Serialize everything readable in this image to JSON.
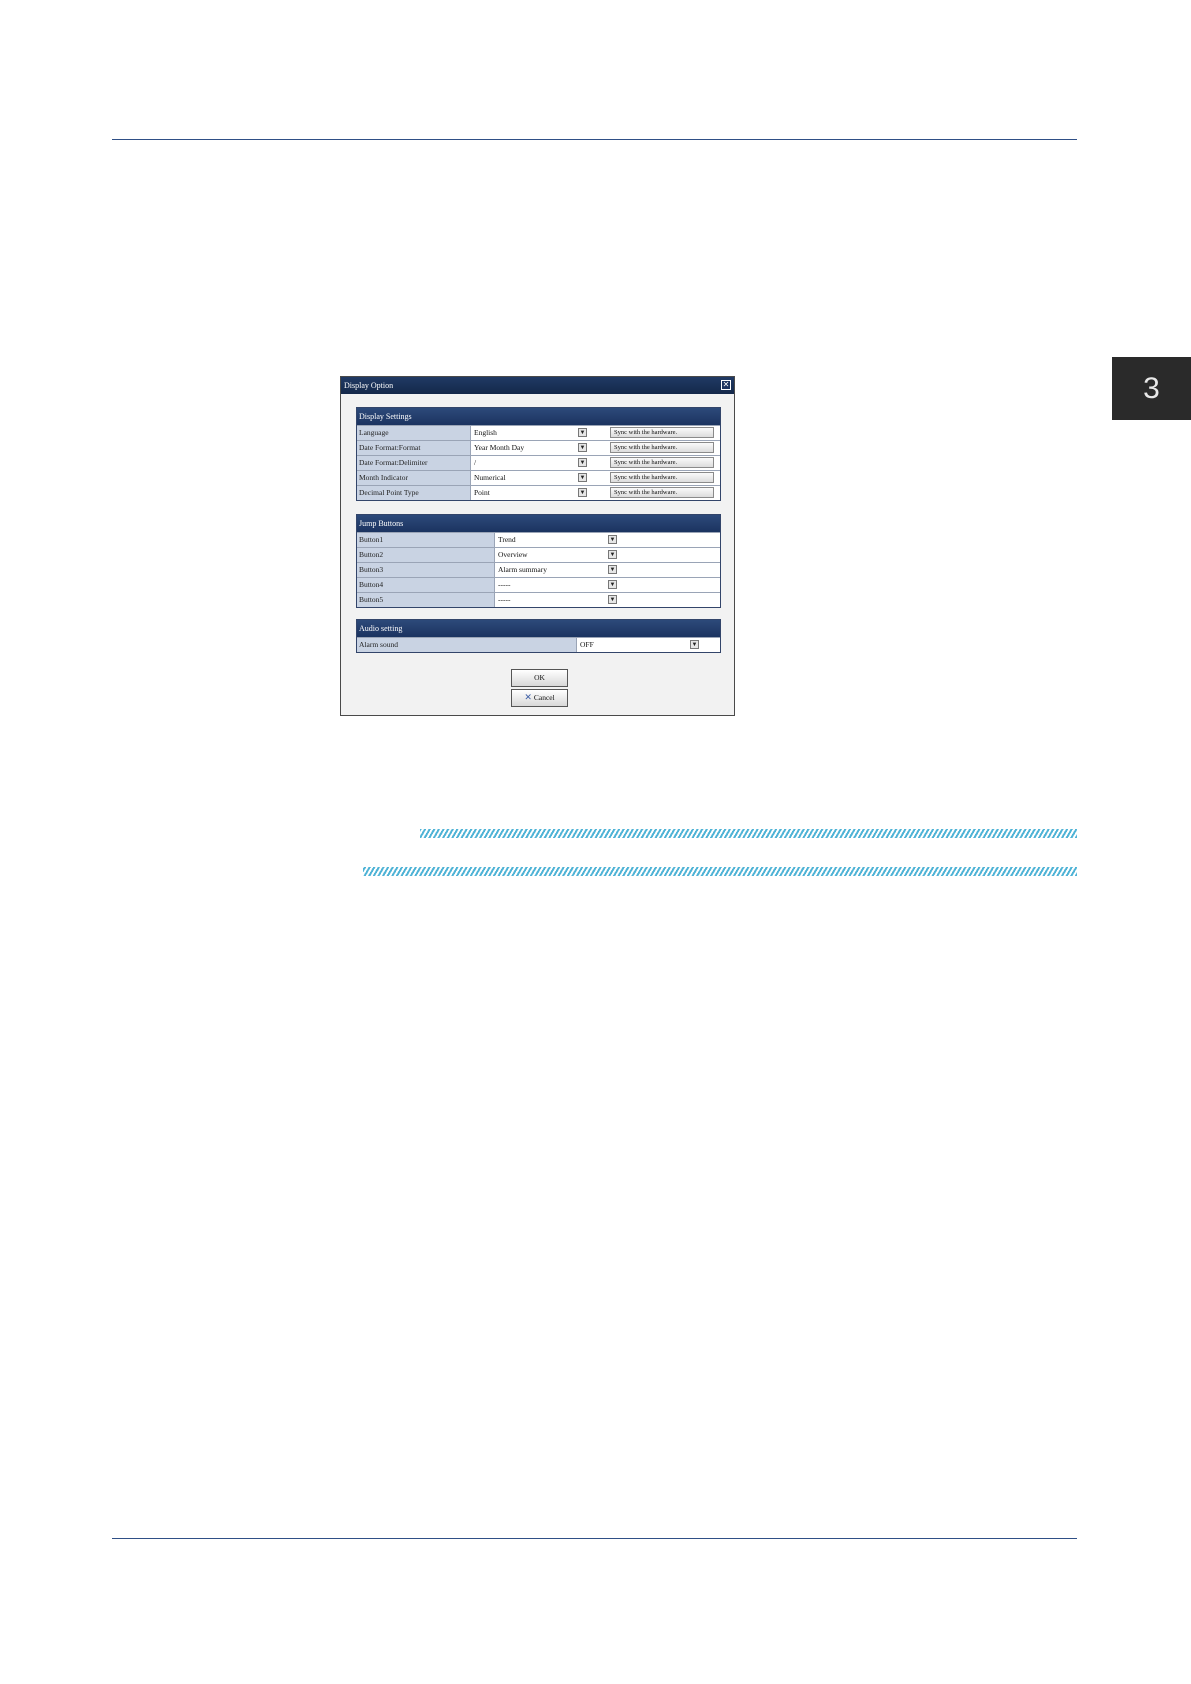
{
  "page": {
    "chapter_number": "3"
  },
  "dialog": {
    "title": "Display Option",
    "sections": {
      "display_settings": {
        "title": "Display Settings",
        "rows": [
          {
            "label": "Language",
            "value": "English",
            "sync": "Sync with the hardware."
          },
          {
            "label": "Date Format:Format",
            "value": "Year Month Day",
            "sync": "Sync with the hardware."
          },
          {
            "label": "Date Format:Delimiter",
            "value": "/",
            "sync": "Sync with the hardware."
          },
          {
            "label": "Month Indicator",
            "value": "Numerical",
            "sync": "Sync with the hardware."
          },
          {
            "label": "Decimal Point Type",
            "value": "Point",
            "sync": "Sync with the hardware."
          }
        ]
      },
      "jump_buttons": {
        "title": "Jump Buttons",
        "rows": [
          {
            "label": "Button1",
            "value": "Trend"
          },
          {
            "label": "Button2",
            "value": "Overview"
          },
          {
            "label": "Button3",
            "value": "Alarm summary"
          },
          {
            "label": "Button4",
            "value": "-----"
          },
          {
            "label": "Button5",
            "value": "-----"
          }
        ]
      },
      "audio_setting": {
        "title": "Audio setting",
        "rows": [
          {
            "label": "Alarm sound",
            "value": "OFF"
          }
        ]
      }
    },
    "buttons": {
      "ok": "OK",
      "cancel": "Cancel"
    }
  }
}
